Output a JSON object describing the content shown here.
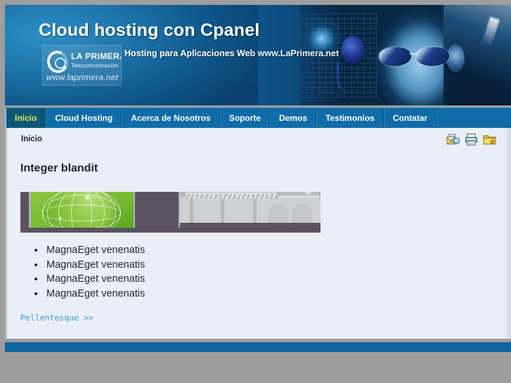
{
  "header": {
    "title": "Cloud hosting con Cpanel",
    "tagline_prefix": "Hosting para Aplicaciones Web ",
    "tagline_highlight": "www.LaPrimera.net",
    "logo": {
      "name": "LA PRIMERA",
      "sub": "Telecomunicación",
      "url": "www.laprimera.net",
      "mark": "ring-logo-icon"
    },
    "photo_alt": "woman-with-headset-photo"
  },
  "nav": {
    "items": [
      {
        "label": "Inicio",
        "active": true
      },
      {
        "label": "Cloud Hosting",
        "active": false
      },
      {
        "label": "Acerca de Nosotros",
        "active": false
      },
      {
        "label": "Soporte",
        "active": false
      },
      {
        "label": "Demos",
        "active": false
      },
      {
        "label": "Testimonios",
        "active": false
      },
      {
        "label": "Contatar",
        "active": false
      }
    ]
  },
  "breadcrumb": {
    "label": "Inicio"
  },
  "tools": [
    {
      "name": "email-icon",
      "title": "Email"
    },
    {
      "name": "print-icon",
      "title": "Imprimir"
    },
    {
      "name": "bookmark-folder-icon",
      "title": "Favoritos"
    }
  ],
  "main": {
    "heading": "Integer blandit",
    "banner_alt": "green-globe-and-industrial-banner",
    "bullets": [
      "MagnaEget venenatis",
      "MagnaEget venenatis",
      "MagnaEget venenatis",
      "MagnaEget venenatis"
    ],
    "more_link": "Pellentesque >>"
  },
  "colors": {
    "nav_blue": "#0f6ca8",
    "nav_active_bg": "#0d5878",
    "nav_active_text": "#e8e85a",
    "panel_bg": "#eaeff7",
    "page_bg": "#9e9e9e",
    "footer_blue": "#10639d",
    "link_blue": "#3f9cd6",
    "banner_green": "#8cc63f",
    "banner_dark": "#5b5360"
  }
}
